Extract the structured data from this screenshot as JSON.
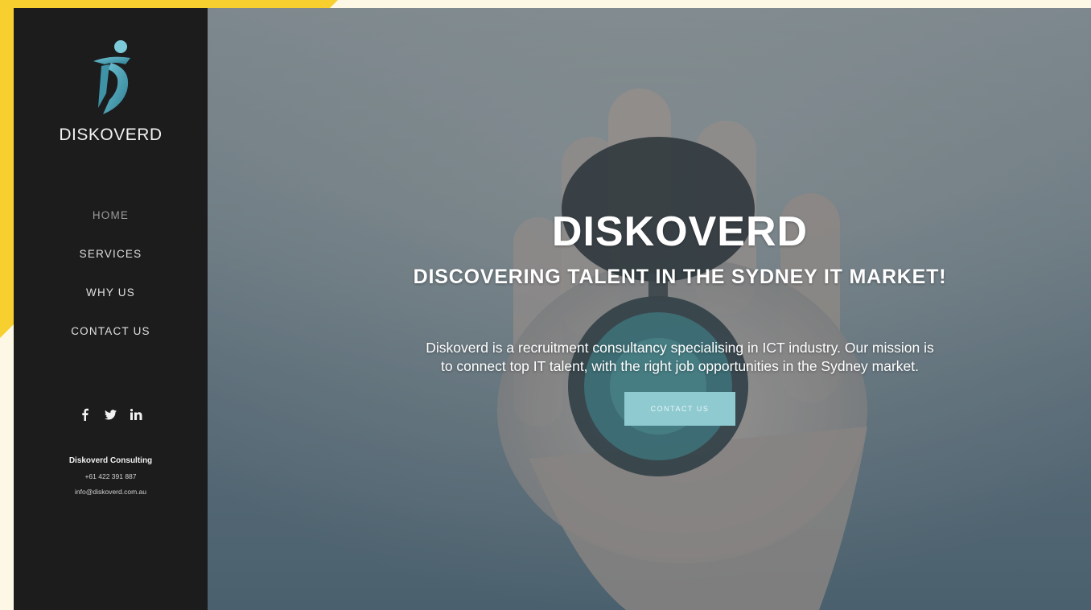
{
  "brand": {
    "name": "DISKOVERD",
    "logo_icon": "figure-d-logo-icon",
    "accent_color": "#4a9fb0"
  },
  "nav": {
    "items": [
      {
        "label": "HOME",
        "active": true
      },
      {
        "label": "SERVICES",
        "active": false
      },
      {
        "label": "WHY US",
        "active": false
      },
      {
        "label": "CONTACT US",
        "active": false
      }
    ]
  },
  "social": {
    "icons": [
      "facebook-icon",
      "twitter-icon",
      "linkedin-icon"
    ]
  },
  "contact": {
    "company": "Diskoverd Consulting",
    "phone": "+61 422 391 887",
    "email": "info@diskoverd.com.au"
  },
  "hero": {
    "title": "DISKOVERD",
    "subtitle": "DISCOVERING TALENT IN THE SYDNEY IT MARKET!",
    "description": "Diskoverd is a recruitment consultancy specialising in ICT industry. Our mission is to connect top IT talent, with the right job opportunities in the Sydney market.",
    "cta_label": "CONTACT US",
    "cta_color": "#8fcad1"
  },
  "colors": {
    "sidebar_bg": "#1c1c1d",
    "page_bg": "#fdf8e6",
    "corner_accent": "#f7cf2e"
  }
}
